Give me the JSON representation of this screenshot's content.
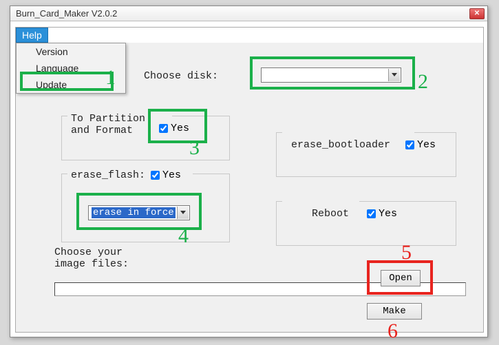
{
  "window": {
    "title": "Burn_Card_Maker V2.0.2"
  },
  "menu": {
    "help": "Help",
    "items": {
      "version": "Version",
      "language": "Language",
      "update": "Update"
    }
  },
  "labels": {
    "choose_disk": "Choose disk:",
    "partition_format": "To Partition and Format",
    "erase_flash": "erase_flash:",
    "erase_bootloader": "erase_bootloader",
    "reboot": "Reboot",
    "choose_image": "Choose your image files:"
  },
  "checkboxes": {
    "partition_yes": "Yes",
    "erase_flash_yes": "Yes",
    "erase_bootloader_yes": "Yes",
    "reboot_yes": "Yes"
  },
  "combos": {
    "disk_value": "",
    "erase_mode_value": "erase in force"
  },
  "buttons": {
    "open": "Open",
    "make": "Make"
  },
  "path": {
    "value": ""
  },
  "annotations": {
    "n1": "1",
    "n2": "2",
    "n3": "3",
    "n4": "4",
    "n5": "5",
    "n6": "6"
  }
}
